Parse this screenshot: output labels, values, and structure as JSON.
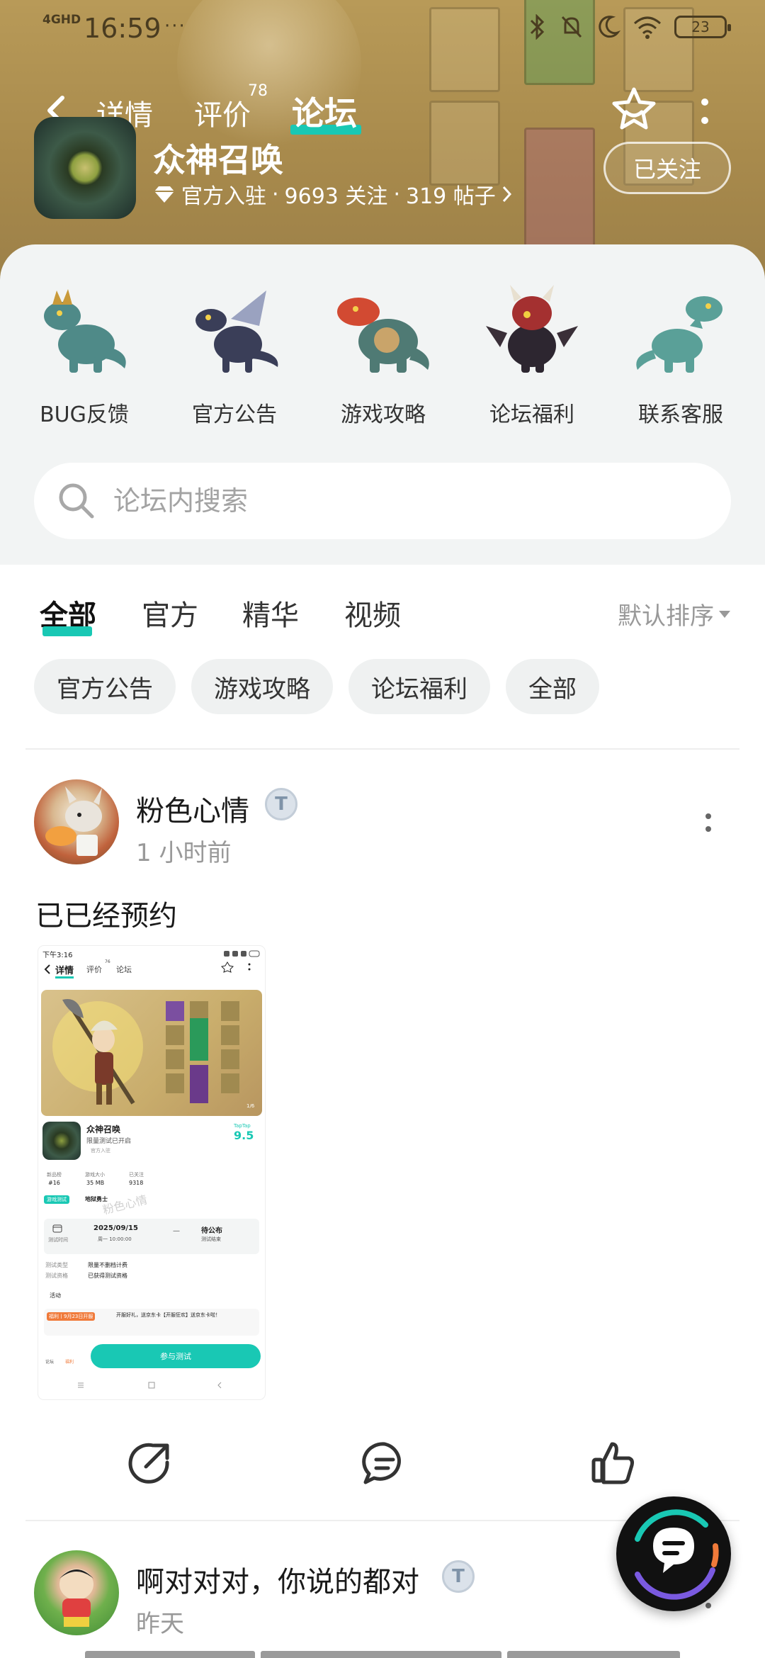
{
  "status_bar": {
    "network": "4GHD",
    "time": "16:59",
    "dots": "···",
    "battery": "23"
  },
  "nav": {
    "tabs": [
      "详情",
      "评价",
      "论坛"
    ],
    "review_count": "78",
    "active_tab": "论坛"
  },
  "game": {
    "title": "众神召唤",
    "badge": "官方入驻",
    "followers": "9693 关注",
    "posts": "319 帖子",
    "separator": "·",
    "follow_label": "已关注"
  },
  "categories": [
    {
      "label": "BUG反馈",
      "color": "#4f8a88"
    },
    {
      "label": "官方公告",
      "color": "#3a3e58"
    },
    {
      "label": "游戏攻略",
      "color": "#4f7a74"
    },
    {
      "label": "论坛福利",
      "color": "#2d2630"
    },
    {
      "label": "联系客服",
      "color": "#5aa098"
    }
  ],
  "search": {
    "placeholder": "论坛内搜索"
  },
  "filter_tabs": [
    "全部",
    "官方",
    "精华",
    "视频"
  ],
  "sort_label": "默认排序",
  "chips": [
    "官方公告",
    "游戏攻略",
    "论坛福利",
    "全部"
  ],
  "posts": [
    {
      "author": "粉色心情",
      "badge": "T",
      "time": "1 小时前",
      "text": "已已经预约"
    },
    {
      "author": "啊对对对，你说的都对",
      "badge": "T",
      "time": "昨天"
    }
  ],
  "embedded": {
    "time": "下午3:16",
    "tabs": [
      "详情",
      "评价",
      "论坛"
    ],
    "tab_sup": "76",
    "page": "1/6",
    "name": "众神召唤",
    "subtitle": "限量测试已开启",
    "official": "官方入驻",
    "taptap": "TapTap",
    "score": "9.5",
    "stats": [
      {
        "label": "新品榜",
        "value": "#16"
      },
      {
        "label": "游戏大小",
        "value": "35 MB"
      },
      {
        "label": "已关注",
        "value": "9318"
      }
    ],
    "test_tag": "游戏测试",
    "test_name": "地狱勇士",
    "watermark": "粉色心情",
    "date": "2025/09/15",
    "date_sub": "周一 10:00:00",
    "date_label": "测试时间",
    "pending": "待公布",
    "pending_sub": "测试结束",
    "rows": [
      {
        "k": "测试类型",
        "v": "限量不删档计费"
      },
      {
        "k": "测试资格",
        "v": "已获得测试资格"
      }
    ],
    "activity": "活动",
    "event_tag": "福利丨9月23日开服",
    "event_text": "开服好礼，送京东卡【开服狂欢】送京东卡啦！",
    "bottom_left": "论坛",
    "bottom_mid": "福利",
    "join": "参与测试"
  }
}
